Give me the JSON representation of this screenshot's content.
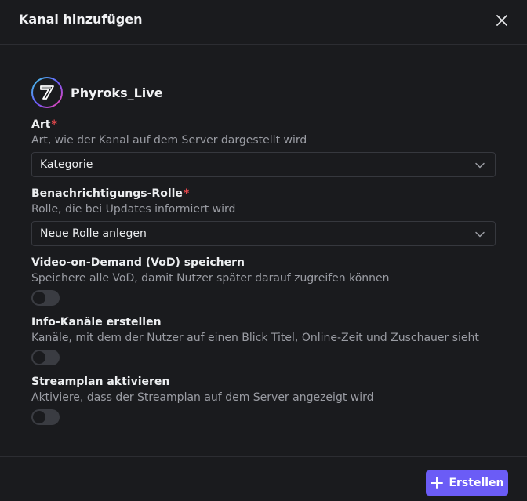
{
  "dialog": {
    "title": "Kanal hinzufügen",
    "close_icon": "close-icon"
  },
  "channel": {
    "name": "Phyroks_Live",
    "avatar_icon": "channel-avatar-logo"
  },
  "fields": {
    "art": {
      "label": "Art",
      "required_mark": "*",
      "description": "Art, wie der Kanal auf dem Server dargestellt wird",
      "value": "Kategorie"
    },
    "notification_role": {
      "label": "Benachrichtigungs-Rolle",
      "required_mark": "*",
      "description": "Rolle, die bei Updates informiert wird",
      "value": "Neue Rolle anlegen"
    },
    "vod": {
      "label": "Video-on-Demand (VoD) speichern",
      "description": "Speichere alle VoD, damit Nutzer später darauf zugreifen können",
      "enabled": false
    },
    "info_channels": {
      "label": "Info-Kanäle erstellen",
      "description": "Kanäle, mit dem der Nutzer auf einen Blick Titel, Online-Zeit und Zuschauer sieht",
      "enabled": false
    },
    "streamplan": {
      "label": "Streamplan aktivieren",
      "description": "Aktiviere, dass der Streamplan auf dem Server angezeigt wird",
      "enabled": false
    }
  },
  "footer": {
    "create_label": "Erstellen",
    "create_icon": "plus-icon"
  },
  "colors": {
    "background": "#1a1b1e",
    "accent": "#6b5cf6",
    "required": "#e5484d",
    "muted_text": "#9a9ca3"
  }
}
